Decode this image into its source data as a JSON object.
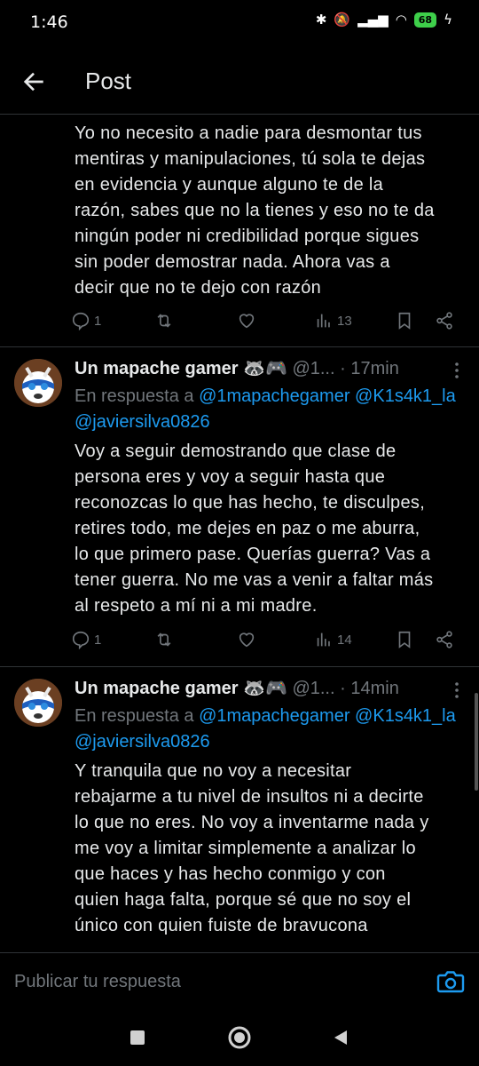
{
  "status_bar": {
    "time": "1:46",
    "battery": "68"
  },
  "header": {
    "title": "Post"
  },
  "tweets": [
    {
      "text": "Yo no necesito a nadie para desmontar tus\nmentiras y manipulaciones, tú sola te dejas\nen evidencia y aunque alguno te de la\nrazón, sabes que no la tienes y eso no te da\nningún poder ni credibilidad porque sigues\nsin poder demostrar nada. Ahora vas a\ndecir que no te dejo con razón",
      "replies": "1",
      "views": "13"
    },
    {
      "name": "Un mapache gamer",
      "emoji": "🦝🎮",
      "handle": "@1...",
      "time": "· 17min",
      "reply_prefix": "En respuesta a",
      "mention1": "@1mapachegamer",
      "mention2": "@K1s4k1_la",
      "mention3": "@javiersilva0826",
      "text": "Voy a seguir demostrando que clase de\npersona eres y voy a seguir hasta que\nreconozcas lo que has hecho, te disculpes,\nretires todo, me dejes en paz o me aburra,\nlo que primero pase. Querías guerra? Vas a\ntener guerra. No me vas a venir a faltar más\nal respeto a mí ni a mi madre.",
      "replies": "1",
      "views": "14"
    },
    {
      "name": "Un mapache gamer",
      "emoji": "🦝🎮",
      "handle": "@1...",
      "time": "· 14min",
      "reply_prefix": "En respuesta a",
      "mention1": "@1mapachegamer",
      "mention2": "@K1s4k1_la",
      "mention3": "@javiersilva0826",
      "text": "Y tranquila que no voy a necesitar\nrebajarme a tu nivel de insultos ni a decirte\nlo que no eres. No voy a inventarme nada y\nme voy a limitar simplemente a analizar lo\nque haces y has hecho conmigo y con\nquien haga falta, porque sé que no soy el\núnico con quien fuiste de bravucona"
    }
  ],
  "reply_bar": {
    "placeholder": "Publicar tu respuesta"
  },
  "icons": {
    "back": "arrow-left-icon",
    "reply": "reply-bubble-icon",
    "retweet": "retweet-icon",
    "like": "heart-icon",
    "views": "views-chart-icon",
    "bookmark": "bookmark-icon",
    "share": "share-icon",
    "camera": "camera-icon"
  },
  "colors": {
    "accent": "#1d9bf0",
    "muted": "#71767b",
    "text": "#e7e9ea",
    "background": "#000000"
  }
}
